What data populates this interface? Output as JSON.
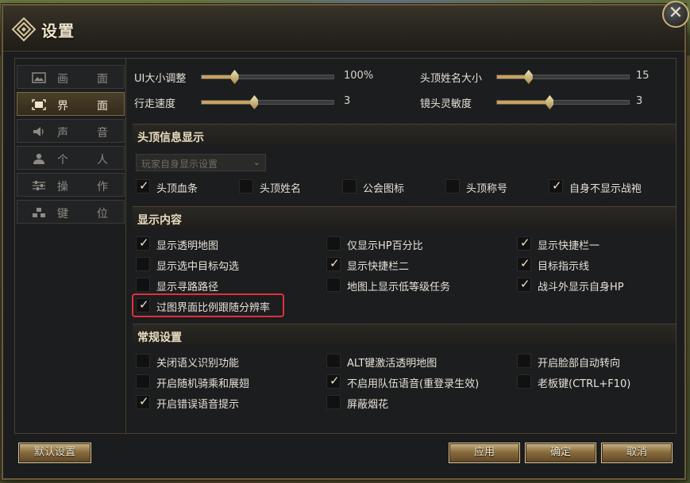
{
  "window": {
    "title": "设置",
    "close_glyph": "✕"
  },
  "sidebar": {
    "items": [
      {
        "label": "画面",
        "icon": "image-icon",
        "active": false
      },
      {
        "label": "界面",
        "icon": "frame-icon",
        "active": true
      },
      {
        "label": "声音",
        "icon": "speaker-icon",
        "active": false
      },
      {
        "label": "个人",
        "icon": "person-icon",
        "active": false
      },
      {
        "label": "操作",
        "icon": "sliders-icon",
        "active": false
      },
      {
        "label": "键位",
        "icon": "keys-icon",
        "active": false
      }
    ]
  },
  "sliders": [
    {
      "label": "UI大小调整",
      "value": "100%",
      "fraction": 0.25
    },
    {
      "label": "头顶姓名大小",
      "value": "15",
      "fraction": 0.24
    },
    {
      "label": "行走速度",
      "value": "3",
      "fraction": 0.4
    },
    {
      "label": "镜头灵敏度",
      "value": "3",
      "fraction": 0.4
    }
  ],
  "sections": {
    "overhead": "头顶信息显示",
    "display": "显示内容",
    "general": "常规设置"
  },
  "dropdown": {
    "value": "玩家自身显示设置",
    "chevron": "⌄"
  },
  "overhead_checks": [
    {
      "label": "头顶血条",
      "checked": true
    },
    {
      "label": "头顶姓名",
      "checked": false
    },
    {
      "label": "公会图标",
      "checked": false
    },
    {
      "label": "头顶称号",
      "checked": false
    },
    {
      "label": "自身不显示战袍",
      "checked": true
    }
  ],
  "display_checks": [
    {
      "label": "显示透明地图",
      "checked": true
    },
    {
      "label": "仅显示HP百分比",
      "checked": false
    },
    {
      "label": "显示快捷栏一",
      "checked": true
    },
    {
      "label": "显示选中目标勾选",
      "checked": false
    },
    {
      "label": "显示快捷栏二",
      "checked": true
    },
    {
      "label": "目标指示线",
      "checked": true
    },
    {
      "label": "显示寻路路径",
      "checked": false
    },
    {
      "label": "地图上显示低等级任务",
      "checked": false
    },
    {
      "label": "战斗外显示自身HP",
      "checked": true
    },
    {
      "label": "过图界面比例跟随分辨率",
      "checked": true
    }
  ],
  "general_checks": [
    {
      "label": "关闭语义识别功能",
      "checked": false
    },
    {
      "label": "ALT键激活透明地图",
      "checked": false
    },
    {
      "label": "开启脸部自动转向",
      "checked": false
    },
    {
      "label": "开启随机骑乘和展翅",
      "checked": false
    },
    {
      "label": "不启用队伍语音(重登录生效)",
      "checked": true
    },
    {
      "label": "老板键(CTRL+F10)",
      "checked": false
    },
    {
      "label": "开启错误语音提示",
      "checked": true
    },
    {
      "label": "屏蔽烟花",
      "checked": false
    }
  ],
  "tick_glyph": "✓",
  "buttons": {
    "default": "默认设置",
    "apply": "应用",
    "ok": "确定",
    "cancel": "取消"
  },
  "colors": {
    "accent": "#c9a25a",
    "highlight": "#e0303a"
  }
}
